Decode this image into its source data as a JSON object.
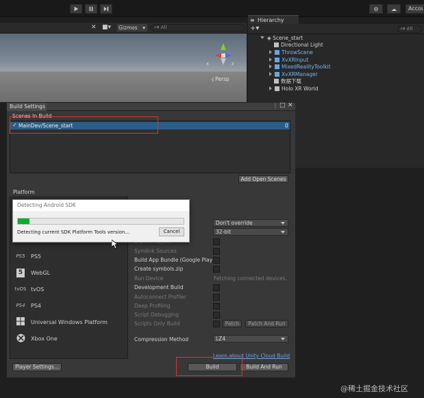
{
  "toolbar": {
    "play_icon": "play-icon",
    "pause_icon": "pause-icon",
    "step_icon": "step-icon",
    "cloud_icon": "cloud-icon",
    "account_label": "Accou"
  },
  "scene": {
    "gizmos_label": "Gizmos",
    "search_placeholder": "All",
    "persp_label": "Persp",
    "axis_x": "x",
    "axis_z": "z"
  },
  "hierarchy": {
    "tab_label": "Hierarchy",
    "search_placeholder": "All",
    "items": [
      {
        "label": "Scene_start",
        "indent": 0
      },
      {
        "label": "Directional Light",
        "indent": 1
      },
      {
        "label": "ThrowScene",
        "indent": 1
      },
      {
        "label": "XvXRInput",
        "indent": 1
      },
      {
        "label": "MixedRealityToolkit",
        "indent": 1
      },
      {
        "label": "XvXRManager",
        "indent": 1
      },
      {
        "label": "数据下载",
        "indent": 1
      },
      {
        "label": "Holo XR World",
        "indent": 1
      }
    ]
  },
  "build_settings": {
    "title": "Build Settings",
    "scenes_in_build_label": "Scenes In Build",
    "scene_entry": "MainDev/Scene_start",
    "scene_index": "0",
    "add_open_scenes": "Add Open Scenes",
    "platform_label": "Platform",
    "platforms": [
      {
        "name": "PS5",
        "icon": "PS5"
      },
      {
        "name": "WebGL",
        "icon": "5"
      },
      {
        "name": "tvOS",
        "icon": "tvOS"
      },
      {
        "name": "PS4",
        "icon": "PS4"
      },
      {
        "name": "Universal Windows Platform",
        "icon": "windows"
      },
      {
        "name": "Xbox One",
        "icon": "xbox"
      }
    ],
    "options": {
      "texture_value": "Don't override",
      "arch_value": "32-bit",
      "export_project": "Export Project",
      "symlink_sources": "Symlink Sources",
      "build_app_bundle": "Build App Bundle (Google Play",
      "create_symbols": "Create symbols.zip",
      "run_device": "Run Device",
      "run_device_value": "Fetching connected devices.",
      "development_build": "Development Build",
      "autoconnect_profiler": "Autoconnect Profiler",
      "deep_profiling": "Deep Profiling",
      "script_debugging": "Script Debugging",
      "scripts_only_build": "Scripts Only Build",
      "patch": "Patch",
      "patch_and_run": "Patch And Run",
      "compression_method": "Compression Method",
      "compression_value": "LZ4"
    },
    "cloud_link": "Learn about Unity Cloud Build",
    "player_settings": "Player Settings...",
    "build": "Build",
    "build_and_run": "Build And Run"
  },
  "dialog": {
    "title": "Detecting Android SDK",
    "progress": 0.07,
    "message": "Detecting current SDK Platform Tools version...",
    "cancel": "Cancel"
  },
  "watermark": "@稀土掘金技术社区"
}
